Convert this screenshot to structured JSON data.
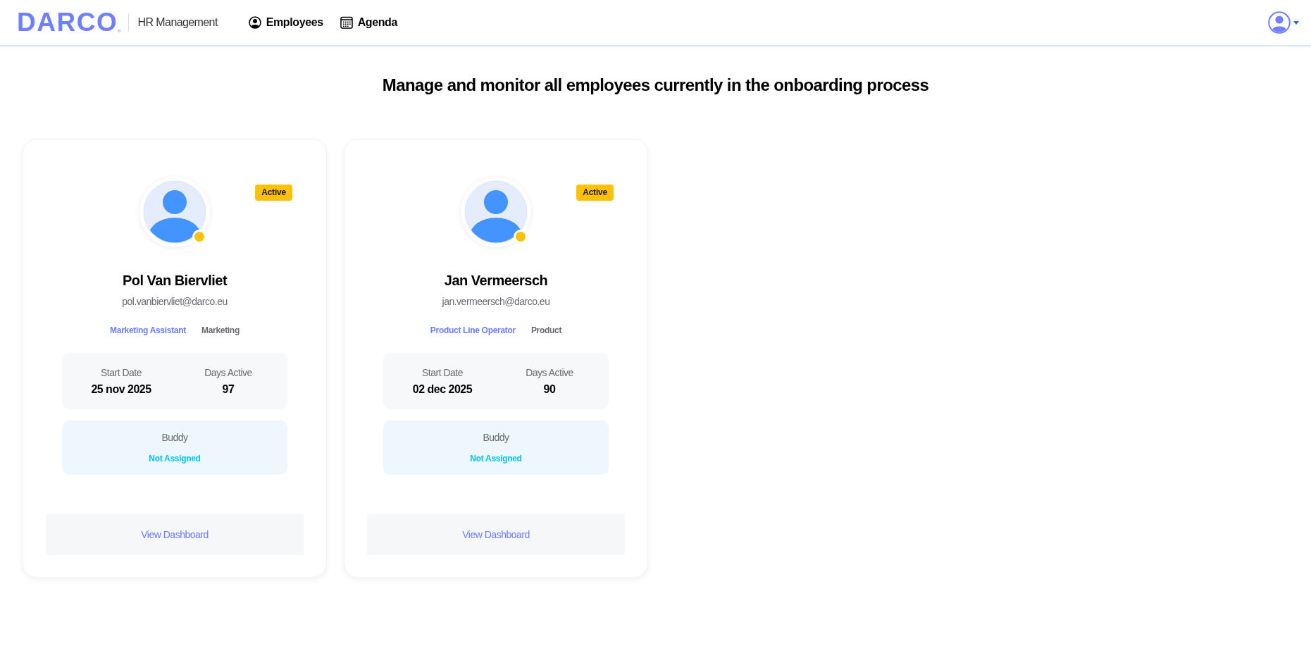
{
  "header": {
    "logo": "DARCO",
    "logo_mark": "®",
    "app_name": "HR Management",
    "nav": [
      {
        "label": "Employees",
        "kind": "user"
      },
      {
        "label": "Agenda",
        "kind": "calendar"
      }
    ]
  },
  "page_title": "Manage and monitor all employees currently in the onboarding process",
  "employees": [
    {
      "name": "Pol Van Biervliet",
      "email": "pol.vanbiervliet@darco.eu",
      "status": "Active",
      "color": "#ffc107",
      "role": "Marketing Assistant",
      "department": "Marketing",
      "stats": [
        {
          "label": "Start Date",
          "value": "25 nov 2025"
        },
        {
          "label": "Days Active",
          "value": "97"
        }
      ],
      "buddy": {
        "label": "Buddy",
        "value": "Not Assigned"
      },
      "action": "View Dashboard"
    },
    {
      "name": "Jan Vermeersch",
      "email": "jan.vermeersch@darco.eu",
      "status": "Active",
      "color": "#ffc107",
      "role": "Product Line Operator",
      "department": "Product",
      "stats": [
        {
          "label": "Start Date",
          "value": "02 dec 2025"
        },
        {
          "label": "Days Active",
          "value": "90"
        }
      ],
      "buddy": {
        "label": "Buddy",
        "value": "Not Assigned"
      },
      "action": "View Dashboard"
    }
  ]
}
